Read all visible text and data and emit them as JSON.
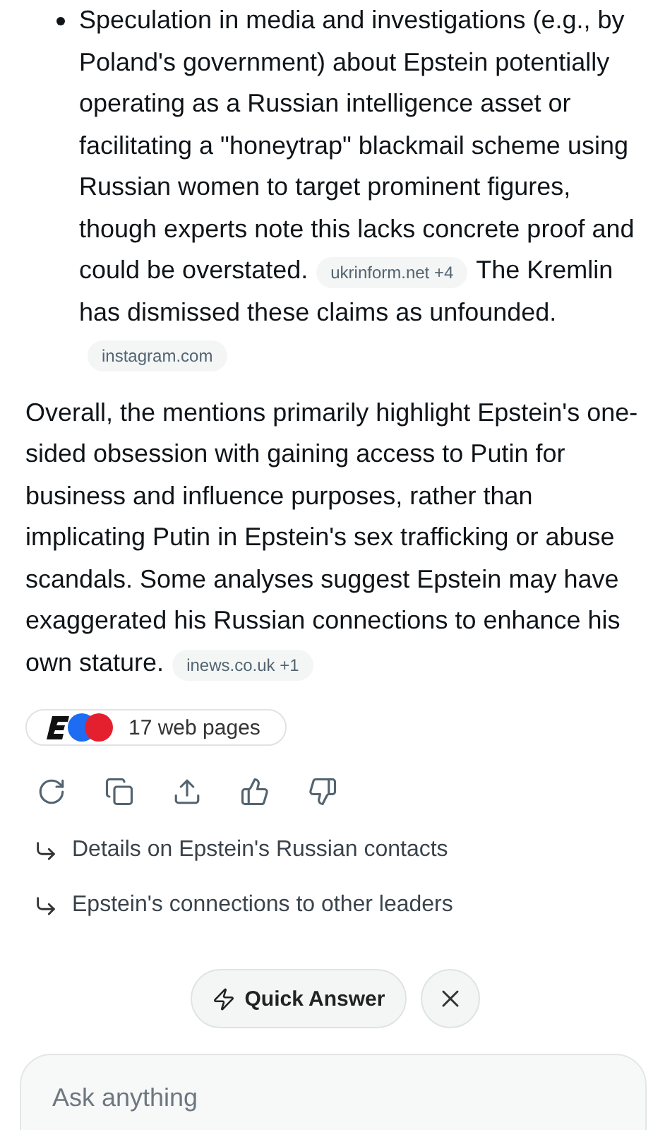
{
  "bullet_items": [
    {
      "segments": [
        {
          "kind": "text",
          "text": "Speculation in media and investigations (e.g., by Poland's government) about Epstein potentially operating as a Russian intelligence asset or facilitating a \"honeytrap\" blackmail scheme using Russian women to target prominent figures, though experts note this lacks concrete proof and could be overstated."
        },
        {
          "kind": "source",
          "text": "ukrinform.net +4"
        },
        {
          "kind": "text",
          "text": "The Kremlin has dismissed these claims as unfounded."
        },
        {
          "kind": "source",
          "text": "instagram.com"
        }
      ]
    }
  ],
  "paragraph": {
    "segments": [
      {
        "kind": "text",
        "text": "Overall, the mentions primarily highlight Epstein's one-sided obsession with gaining access to Putin for business and influence purposes, rather than implicating Putin in Epstein's sex trafficking or abuse scandals. Some analyses suggest Epstein may have exaggerated his Russian connections to enhance his own stature."
      },
      {
        "kind": "source",
        "text": "inews.co.uk +1"
      }
    ]
  },
  "sources_button": {
    "label": "17 web pages"
  },
  "actions": [
    {
      "kind": "regenerate"
    },
    {
      "kind": "copy"
    },
    {
      "kind": "share"
    },
    {
      "kind": "like"
    },
    {
      "kind": "dislike"
    }
  ],
  "suggestions": [
    {
      "text": "Details on Epstein's Russian contacts"
    },
    {
      "text": "Epstein's connections to other leaders"
    }
  ],
  "quick_answer": {
    "label": "Quick Answer"
  },
  "input": {
    "placeholder": "Ask anything"
  }
}
